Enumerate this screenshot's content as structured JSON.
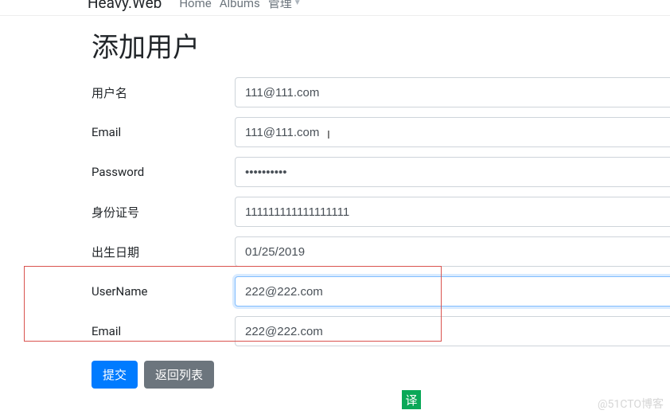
{
  "navbar": {
    "brand": "Heavy.Web",
    "links": [
      "Home",
      "Albums"
    ],
    "admin_label": "管理"
  },
  "page": {
    "title": "添加用户"
  },
  "form": {
    "username": {
      "label": "用户名",
      "value": "111@111.com"
    },
    "email": {
      "label": "Email",
      "value": "111@111.com"
    },
    "password": {
      "label": "Password",
      "value": "••••••••••"
    },
    "idcard": {
      "label": "身份证号",
      "value": "111111111111111111"
    },
    "birthdate": {
      "label": "出生日期",
      "value": "01/25/2019"
    },
    "username2": {
      "label": "UserName",
      "value": "222@222.com"
    },
    "email2": {
      "label": "Email",
      "value": "222@222.com"
    }
  },
  "buttons": {
    "submit": "提交",
    "back": "返回列表"
  },
  "translate_icon": "译",
  "watermark": "@51CTO博客"
}
